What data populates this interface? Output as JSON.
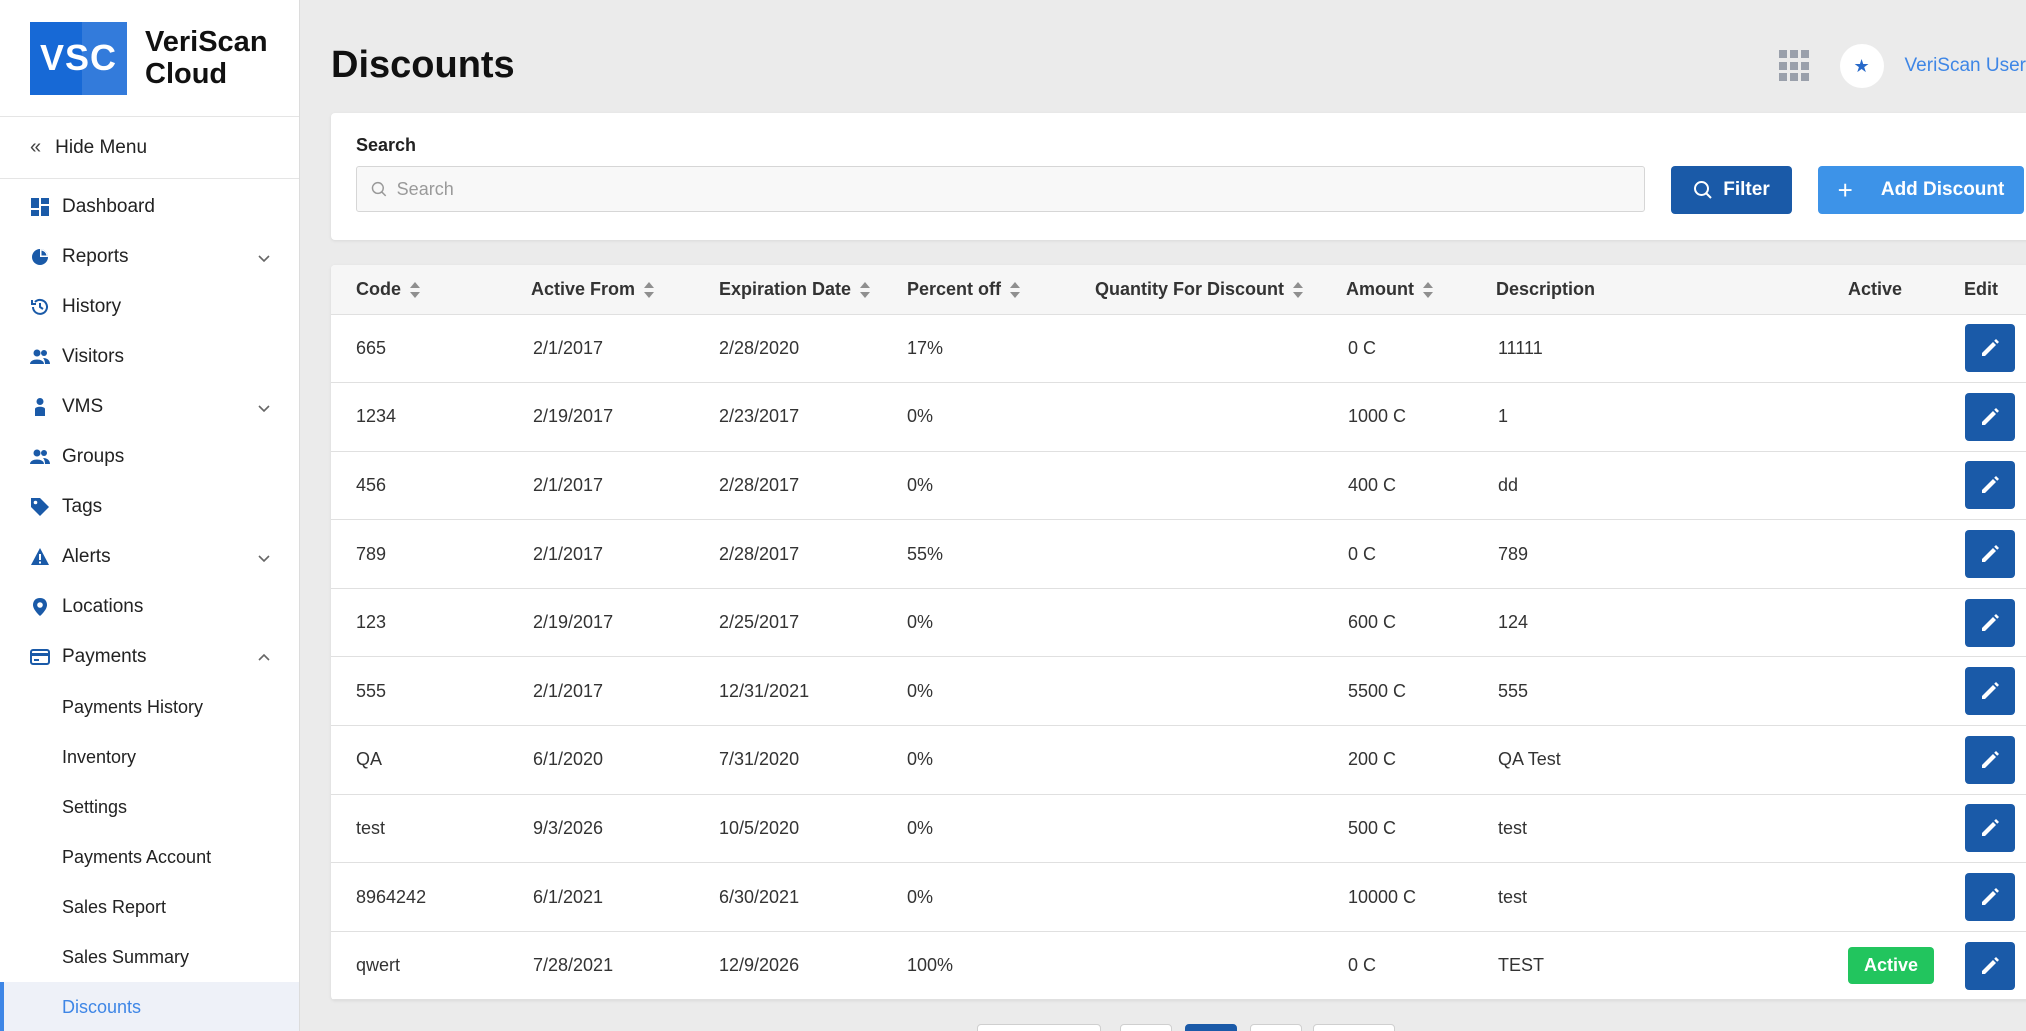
{
  "logo": {
    "abbr": "VSC",
    "line1": "VeriScan",
    "line2": "Cloud"
  },
  "sidebar": {
    "hide_menu": "Hide Menu",
    "items": [
      {
        "label": "Dashboard",
        "icon": "dashboard-icon"
      },
      {
        "label": "Reports",
        "icon": "pie-chart-icon",
        "expandable": true,
        "expanded": false
      },
      {
        "label": "History",
        "icon": "history-icon"
      },
      {
        "label": "Visitors",
        "icon": "users-icon"
      },
      {
        "label": "VMS",
        "icon": "person-icon",
        "expandable": true,
        "expanded": false
      },
      {
        "label": "Groups",
        "icon": "users-icon"
      },
      {
        "label": "Tags",
        "icon": "tag-icon"
      },
      {
        "label": "Alerts",
        "icon": "warning-icon",
        "expandable": true,
        "expanded": false
      },
      {
        "label": "Locations",
        "icon": "location-pin-icon"
      },
      {
        "label": "Payments",
        "icon": "payments-icon",
        "expandable": true,
        "expanded": true
      }
    ],
    "payments_sub": [
      {
        "label": "Payments History"
      },
      {
        "label": "Inventory"
      },
      {
        "label": "Settings"
      },
      {
        "label": "Payments Account"
      },
      {
        "label": "Sales Report"
      },
      {
        "label": "Sales Summary"
      },
      {
        "label": "Discounts",
        "active": true
      }
    ]
  },
  "header": {
    "title": "Discounts",
    "user": "VeriScan User"
  },
  "search": {
    "label": "Search",
    "placeholder": "Search",
    "value": ""
  },
  "buttons": {
    "filter": "Filter",
    "add": "Add Discount"
  },
  "table": {
    "columns": [
      {
        "label": "Code",
        "sortable": true
      },
      {
        "label": "Active From",
        "sortable": true
      },
      {
        "label": "Expiration Date",
        "sortable": true
      },
      {
        "label": "Percent off",
        "sortable": true
      },
      {
        "label": "Quantity For Discount",
        "sortable": true
      },
      {
        "label": "Amount",
        "sortable": true
      },
      {
        "label": "Description",
        "sortable": false
      },
      {
        "label": "Active",
        "sortable": false
      },
      {
        "label": "Edit",
        "sortable": false
      }
    ],
    "active_label": "Active",
    "rows": [
      {
        "code": "665",
        "active_from": "2/1/2017",
        "expiration": "2/28/2020",
        "percent_off": "17%",
        "quantity": "",
        "amount": "0 C",
        "description": "11111",
        "active": false
      },
      {
        "code": "1234",
        "active_from": "2/19/2017",
        "expiration": "2/23/2017",
        "percent_off": "0%",
        "quantity": "",
        "amount": "1000 C",
        "description": "1",
        "active": false
      },
      {
        "code": "456",
        "active_from": "2/1/2017",
        "expiration": "2/28/2017",
        "percent_off": "0%",
        "quantity": "",
        "amount": "400 C",
        "description": "dd",
        "active": false
      },
      {
        "code": "789",
        "active_from": "2/1/2017",
        "expiration": "2/28/2017",
        "percent_off": "55%",
        "quantity": "",
        "amount": "0 C",
        "description": "789",
        "active": false
      },
      {
        "code": "123",
        "active_from": "2/19/2017",
        "expiration": "2/25/2017",
        "percent_off": "0%",
        "quantity": "",
        "amount": "600 C",
        "description": "124",
        "active": false
      },
      {
        "code": "555",
        "active_from": "2/1/2017",
        "expiration": "12/31/2021",
        "percent_off": "0%",
        "quantity": "",
        "amount": "5500 C",
        "description": "555",
        "active": false
      },
      {
        "code": "QA",
        "active_from": "6/1/2020",
        "expiration": "7/31/2020",
        "percent_off": "0%",
        "quantity": "",
        "amount": "200 C",
        "description": "QA Test",
        "active": false
      },
      {
        "code": "test",
        "active_from": "9/3/2026",
        "expiration": "10/5/2020",
        "percent_off": "0%",
        "quantity": "",
        "amount": "500 C",
        "description": "test",
        "active": false
      },
      {
        "code": "8964242",
        "active_from": "6/1/2021",
        "expiration": "6/30/2021",
        "percent_off": "0%",
        "quantity": "",
        "amount": "10000 C",
        "description": "test",
        "active": false
      },
      {
        "code": "qwert",
        "active_from": "7/28/2021",
        "expiration": "12/9/2026",
        "percent_off": "100%",
        "quantity": "",
        "amount": "0 C",
        "description": "TEST",
        "active": true
      }
    ]
  },
  "colors": {
    "primary": "#1a5aa8",
    "accent": "#3d93e8",
    "active_green": "#22c55e",
    "link": "#3e86e6"
  }
}
